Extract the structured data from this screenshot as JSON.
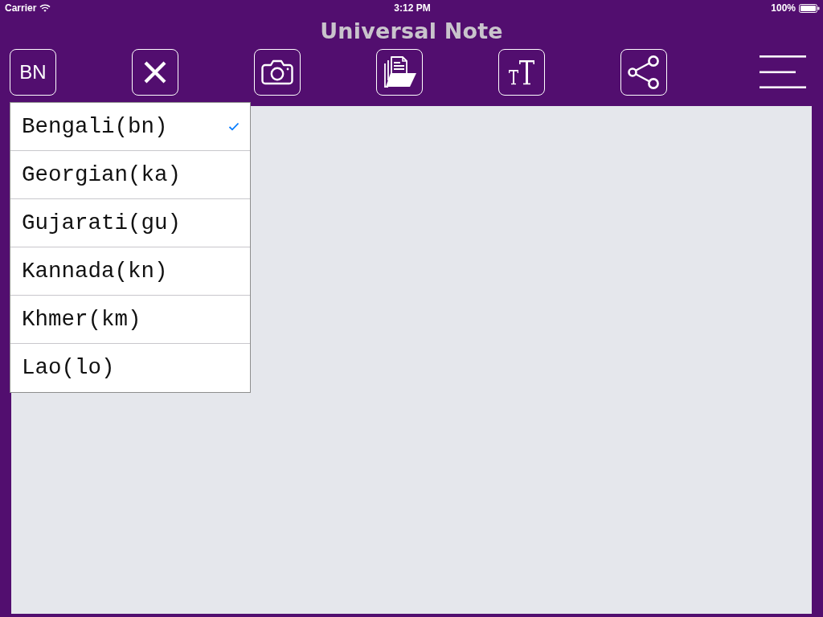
{
  "status_bar": {
    "carrier": "Carrier",
    "time": "3:12 PM",
    "battery": "100%"
  },
  "window": {
    "title": "Universal Note"
  },
  "toolbar": {
    "language_button": "BN"
  },
  "language_menu": {
    "items": [
      {
        "label": "Bengali(bn)",
        "selected": true
      },
      {
        "label": "Georgian(ka)",
        "selected": false
      },
      {
        "label": "Gujarati(gu)",
        "selected": false
      },
      {
        "label": "Kannada(kn)",
        "selected": false
      },
      {
        "label": "Khmer(km)",
        "selected": false
      },
      {
        "label": "Lao(lo)",
        "selected": false
      }
    ]
  }
}
